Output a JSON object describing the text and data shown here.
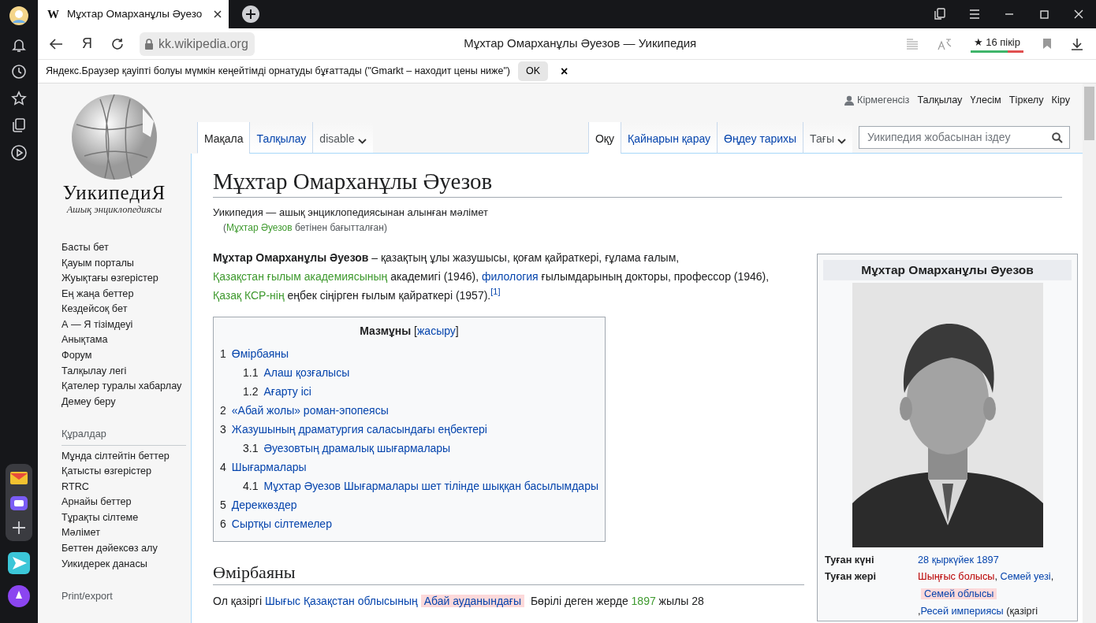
{
  "browser": {
    "tab_title": "Мұхтар Омарханұлы Әуезо",
    "favicon": "W",
    "address": "kk.wikipedia.org",
    "page_title": "Мұхтар Омарханұлы Әуезов — Уикипедия",
    "yandex_key": "Я",
    "rating_star": "★",
    "rating": "16 пікір"
  },
  "infobar": {
    "message": "Яндекс.Браузер қауіпті болуы мүмкін кеңейтімді орнатуды бұғаттады (\"Gmarkt – находит цены ниже\")",
    "ok": "OK",
    "close": "×"
  },
  "wiki": {
    "logo_title": "УикипедиЯ",
    "logo_subtitle": "Ашық энциклопедиясы",
    "navigation": [
      "Басты бет",
      "Қауым порталы",
      "Жуықтағы өзгерістер",
      "Ең жаңа беттер",
      "Кездейсоқ бет",
      "А —  Я тізімдеуі",
      "Анықтама",
      "Форум",
      "Талқылау легі",
      "Қателер туралы хабарлау",
      "Демеу беру"
    ],
    "tools_heading": "Құралдар",
    "tools": [
      "Мұнда сілтейтін беттер",
      "Қатысты өзгерістер",
      "RTRC",
      "Арнайы беттер",
      "Тұрақты сілтеме",
      "Мәлімет",
      "Беттен дәйексөз алу",
      "Уикидерек данасы"
    ],
    "print_heading": "Print/export",
    "personal": {
      "status": "Кірмегенсіз",
      "links": [
        "Талқылау",
        "Үлесім",
        "Тіркелу",
        "Кіру"
      ]
    },
    "left_tabs": [
      {
        "label": "Мақала",
        "selected": true,
        "dropdown": false
      },
      {
        "label": "Талқылау",
        "selected": false,
        "dropdown": false
      },
      {
        "label": "disable",
        "selected": false,
        "dropdown": true
      }
    ],
    "right_tabs": [
      {
        "label": "Оқу",
        "selected": true,
        "dropdown": false
      },
      {
        "label": "Қайнарын қарау",
        "selected": false,
        "dropdown": false
      },
      {
        "label": "Өңдеу тарихы",
        "selected": false,
        "dropdown": false
      },
      {
        "label": "Тағы",
        "selected": false,
        "dropdown": true
      }
    ],
    "search_placeholder": "Уикипедия жобасынан іздеу",
    "title": "Мұхтар Омарханұлы Әуезов",
    "tagline": "Уикипедия — ашық энциклопедиясынан алынған мәлімет",
    "redirect": [
      {
        "text": "(",
        "kind": "text"
      },
      {
        "text": "Мұхтар Әуезов",
        "kind": "visited"
      },
      {
        "text": " бетінен бағытталған)",
        "kind": "text"
      }
    ],
    "intro": [
      {
        "text": "Мұхтар Омарханұлы Әуезов",
        "kind": "bold"
      },
      {
        "text": " – қазақтың ұлы жазушысы, қоғам қайраткері, ғұлама ғалым, ",
        "kind": "text"
      },
      {
        "text": "Қазақстан ғылым академиясының",
        "kind": "visited"
      },
      {
        "text": " академигі (1946), ",
        "kind": "text"
      },
      {
        "text": "филология",
        "kind": "link"
      },
      {
        "text": " ғылымдарының докторы, профессор (1946), ",
        "kind": "text"
      },
      {
        "text": "Қазақ КСР-нің",
        "kind": "visited"
      },
      {
        "text": " еңбек сіңірген ғылым қайраткері (1957).",
        "kind": "text"
      },
      {
        "text": "[1]",
        "kind": "ref"
      }
    ],
    "toc": {
      "heading": "Мазмұны",
      "toggle_open": " [",
      "toggle": "жасыру",
      "toggle_close": "]",
      "items": [
        {
          "number": "1",
          "text": "Өмірбаяны",
          "children": [
            {
              "number": "1.1",
              "text": "Алаш қозғалысы"
            },
            {
              "number": "1.2",
              "text": "Ағарту ісі"
            }
          ]
        },
        {
          "number": "2",
          "text": "«Абай жолы» роман-эпопеясы"
        },
        {
          "number": "3",
          "text": "Жазушының драматургия саласындағы еңбектері",
          "children": [
            {
              "number": "3.1",
              "text": "Әуезовтың драмалық шығармалары"
            }
          ]
        },
        {
          "number": "4",
          "text": "Шығармалары",
          "children": [
            {
              "number": "4.1",
              "text": "Мұхтар Әуезов Шығармалары шет тілінде шыққан басылымдары"
            }
          ]
        },
        {
          "number": "5",
          "text": "Дереккөздер"
        },
        {
          "number": "6",
          "text": "Сыртқы сілтемелер"
        }
      ]
    },
    "section_heading": "Өмірбаяны",
    "section_text": [
      {
        "text": "Ол қазіргі ",
        "kind": "text"
      },
      {
        "text": "Шығыс Қазақстан облысының",
        "kind": "link"
      },
      {
        "text": "Абай ауданындағы",
        "kind": "highlight"
      },
      {
        "text": " Бөрілі деген жерде ",
        "kind": "text"
      },
      {
        "text": "1897",
        "kind": "visited"
      },
      {
        "text": " жылы 28",
        "kind": "text"
      }
    ],
    "infobox": {
      "title": "Мұхтар Омарханұлы Әуезов",
      "rows": [
        {
          "label": "Туған күні",
          "value": [
            {
              "text": "28 қыркүйек 1897",
              "kind": "link"
            }
          ]
        },
        {
          "label": "Туған жері",
          "value": [
            {
              "text": "Шыңғыс болысы",
              "kind": "new"
            },
            {
              "text": ", ",
              "kind": "text"
            },
            {
              "text": "Семей уезі",
              "kind": "link"
            },
            {
              "text": ", ",
              "kind": "text"
            },
            {
              "text": "Семей облысы",
              "kind": "highlight"
            },
            {
              "text": " ,",
              "kind": "text"
            },
            {
              "text": "Ресей империясы",
              "kind": "link"
            },
            {
              "text": " (қазіргі",
              "kind": "text"
            }
          ]
        }
      ]
    }
  }
}
